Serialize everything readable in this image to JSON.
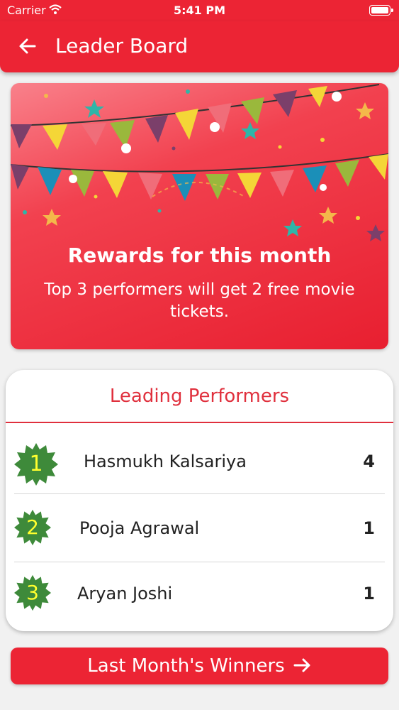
{
  "status_bar": {
    "carrier": "Carrier",
    "time": "5:41 PM",
    "battery_level": 1.0
  },
  "header": {
    "back_icon": "arrow-left-icon",
    "title": "Leader Board"
  },
  "rewards": {
    "headline": "Rewards for this month",
    "description": "Top 3 performers will get 2 free movie tickets."
  },
  "performers": {
    "title": "Leading Performers",
    "rows": [
      {
        "rank": "1",
        "name": "Hasmukh Kalsariya",
        "score": "4"
      },
      {
        "rank": "2",
        "name": "Pooja Agrawal",
        "score": "1"
      },
      {
        "rank": "3",
        "name": "Aryan Joshi",
        "score": "1"
      }
    ]
  },
  "footer_button": {
    "label": "Last Month's Winners",
    "icon": "arrow-right-icon"
  },
  "colors": {
    "primary": "#ec2434",
    "badge": "#3e8a3a",
    "rank_text": "#ffff2e"
  }
}
